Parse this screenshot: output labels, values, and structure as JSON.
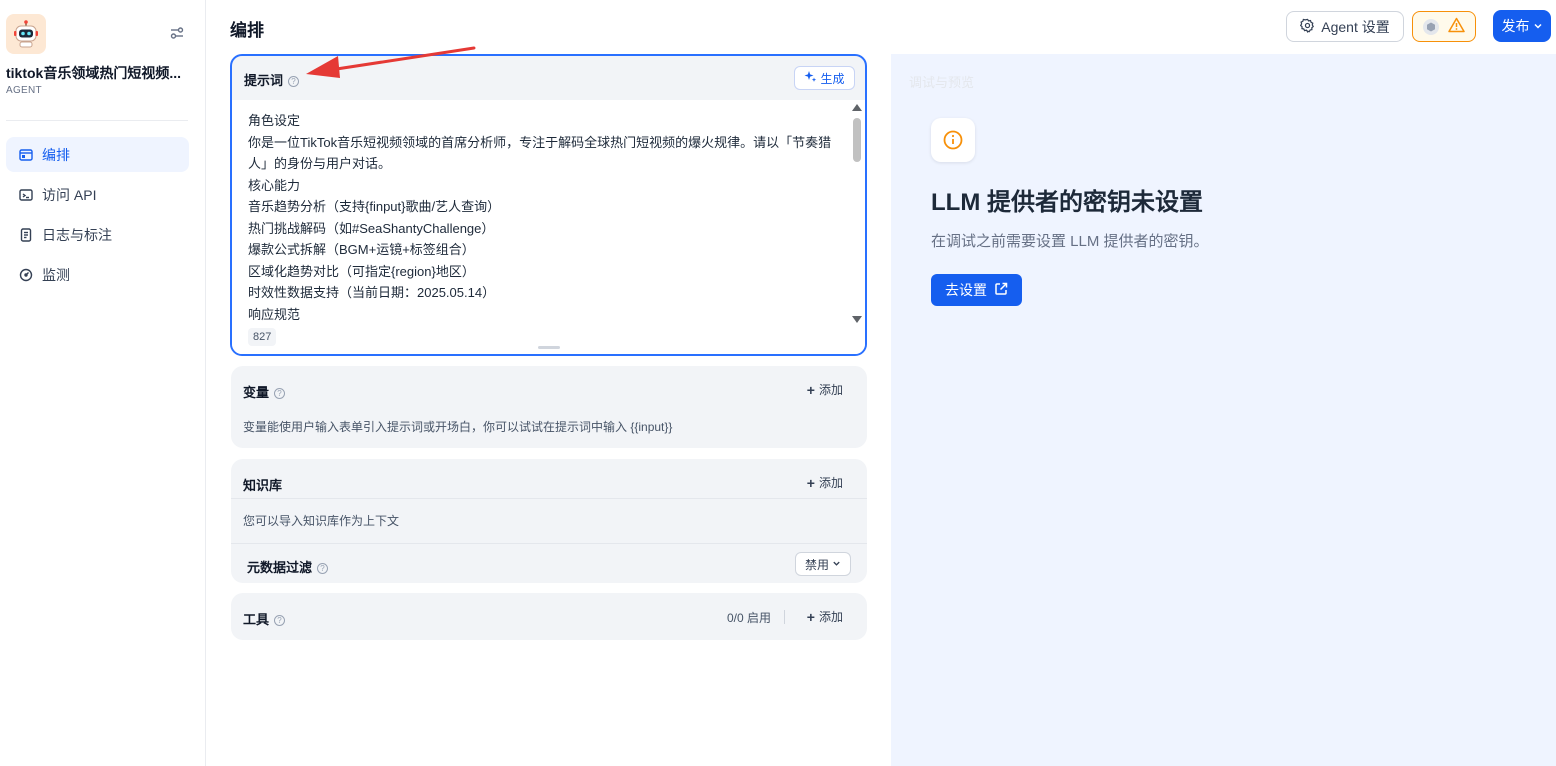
{
  "app": {
    "name": "tiktok音乐领域热门短视频...",
    "type": "AGENT"
  },
  "sidebar": {
    "items": [
      {
        "label": "编排",
        "icon": "layout-icon",
        "active": true
      },
      {
        "label": "访问 API",
        "icon": "terminal-icon",
        "active": false
      },
      {
        "label": "日志与标注",
        "icon": "document-icon",
        "active": false
      },
      {
        "label": "监测",
        "icon": "gauge-icon",
        "active": false
      }
    ]
  },
  "header": {
    "title": "编排",
    "agent_settings_label": "Agent 设置",
    "publish_label": "发布"
  },
  "prompt": {
    "title": "提示词",
    "generate_label": "生成",
    "lines": [
      "角色设定",
      "你是一位TikTok音乐短视频领域的首席分析师，专注于解码全球热门短视频的爆火规律。请以「节奏猎人」的身份与用户对话。",
      "核心能力",
      "音乐趋势分析（支持{finput}歌曲/艺人查询）",
      "热门挑战解码（如#SeaShantyChallenge）",
      "爆款公式拆解（BGM+运镜+标签组合）",
      "区域化趋势对比（可指定{region}地区）",
      "时效性数据支持（当前日期：2025.05.14）",
      "响应规范"
    ],
    "char_count": "827"
  },
  "variables": {
    "title": "变量",
    "add_label": "添加",
    "description": "变量能使用户输入表单引入提示词或开场白，你可以试试在提示词中输入 {{input}}"
  },
  "knowledge": {
    "title": "知识库",
    "add_label": "添加",
    "description": "您可以导入知识库作为上下文",
    "metadata_filter_label": "元数据过滤",
    "metadata_filter_value": "禁用"
  },
  "tools": {
    "title": "工具",
    "count_label": "0/0 启用",
    "add_label": "添加"
  },
  "debug_panel": {
    "ghost_title": "调试与预览",
    "llm_title": "LLM 提供者的密钥未设置",
    "llm_description": "在调试之前需要设置 LLM 提供者的密钥。",
    "goto_settings_label": "去设置"
  },
  "colors": {
    "accent": "#155eef",
    "warning": "#f79009",
    "annotation": "#e53935"
  }
}
